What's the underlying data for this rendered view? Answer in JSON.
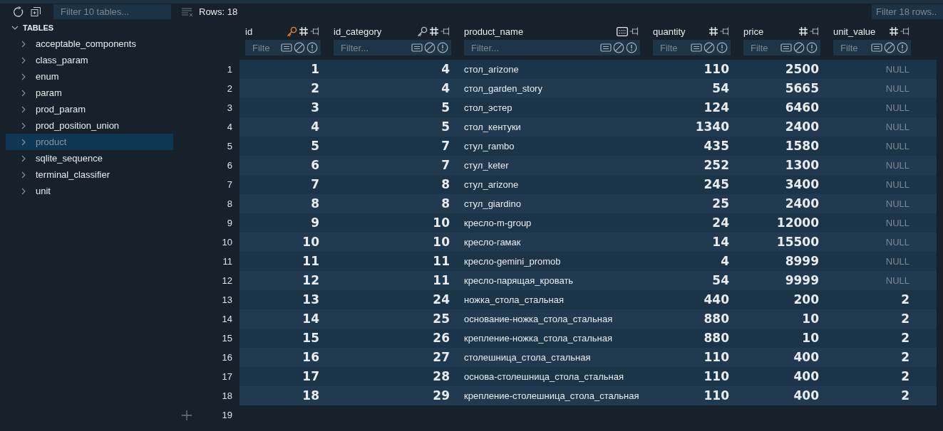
{
  "sidebar": {
    "filter_placeholder": "Filter 10 tables...",
    "section": {
      "label": "TABLES",
      "expanded": true
    },
    "items": [
      {
        "label": "acceptable_components",
        "selected": false
      },
      {
        "label": "class_param",
        "selected": false
      },
      {
        "label": "enum",
        "selected": false
      },
      {
        "label": "param",
        "selected": false
      },
      {
        "label": "prod_param",
        "selected": false
      },
      {
        "label": "prod_position_union",
        "selected": false
      },
      {
        "label": "product",
        "selected": true
      },
      {
        "label": "sqlite_sequence",
        "selected": false
      },
      {
        "label": "terminal_classifier",
        "selected": false
      },
      {
        "label": "unit",
        "selected": false
      }
    ]
  },
  "toolbar": {
    "rows_label": "Rows: 18",
    "filter_placeholder": "Filter 18 rows.."
  },
  "table": {
    "columns": [
      {
        "name": "id",
        "kind": "primary",
        "filter_placeholder": "Filte"
      },
      {
        "name": "id_category",
        "kind": "foreign",
        "filter_placeholder": "Filter..."
      },
      {
        "name": "product_name",
        "kind": "text",
        "filter_placeholder": "Filter..."
      },
      {
        "name": "quantity",
        "kind": "number",
        "filter_placeholder": "Filte"
      },
      {
        "name": "price",
        "kind": "number",
        "filter_placeholder": "Filte"
      },
      {
        "name": "unit_value",
        "kind": "number",
        "filter_placeholder": "Filte"
      }
    ],
    "rows": [
      {
        "number": "1",
        "cells": [
          "1",
          "4",
          "стол_arizone",
          "110",
          "2500",
          {
            "text": "NULL",
            "is_null": true
          }
        ]
      },
      {
        "number": "2",
        "cells": [
          "2",
          "4",
          "стол_garden_story",
          "54",
          "5665",
          {
            "text": "NULL",
            "is_null": true
          }
        ]
      },
      {
        "number": "3",
        "cells": [
          "3",
          "5",
          "стол_эстер",
          "124",
          "6460",
          {
            "text": "NULL",
            "is_null": true
          }
        ]
      },
      {
        "number": "4",
        "cells": [
          "4",
          "5",
          "стол_кентуки",
          "1340",
          "2400",
          {
            "text": "NULL",
            "is_null": true
          }
        ]
      },
      {
        "number": "5",
        "cells": [
          "5",
          "7",
          "стул_rambo",
          "435",
          "1580",
          {
            "text": "NULL",
            "is_null": true
          }
        ]
      },
      {
        "number": "6",
        "cells": [
          "6",
          "7",
          "стул_keter",
          "252",
          "1300",
          {
            "text": "NULL",
            "is_null": true
          }
        ]
      },
      {
        "number": "7",
        "cells": [
          "7",
          "8",
          "стул_arizone",
          "245",
          "3400",
          {
            "text": "NULL",
            "is_null": true
          }
        ]
      },
      {
        "number": "8",
        "cells": [
          "8",
          "8",
          "стул_giardino",
          "25",
          "2400",
          {
            "text": "NULL",
            "is_null": true
          }
        ]
      },
      {
        "number": "9",
        "cells": [
          "9",
          "10",
          "кресло-m-group",
          "24",
          "12000",
          {
            "text": "NULL",
            "is_null": true
          }
        ]
      },
      {
        "number": "10",
        "cells": [
          "10",
          "10",
          "кресло-гамак",
          "14",
          "15500",
          {
            "text": "NULL",
            "is_null": true
          }
        ]
      },
      {
        "number": "11",
        "cells": [
          "11",
          "11",
          "кресло-gemini_promob",
          "4",
          "8999",
          {
            "text": "NULL",
            "is_null": true
          }
        ]
      },
      {
        "number": "12",
        "cells": [
          "12",
          "11",
          "кресло-парящая_кровать",
          "54",
          "9999",
          {
            "text": "NULL",
            "is_null": true
          }
        ]
      },
      {
        "number": "13",
        "cells": [
          "13",
          "24",
          "ножка_стола_стальная",
          "440",
          "200",
          "2"
        ]
      },
      {
        "number": "14",
        "cells": [
          "14",
          "25",
          "основание-ножка_стола_стальная",
          "880",
          "10",
          "2"
        ]
      },
      {
        "number": "15",
        "cells": [
          "15",
          "26",
          "крепление-ножка_стола_стальная",
          "880",
          "10",
          "2"
        ]
      },
      {
        "number": "16",
        "cells": [
          "16",
          "27",
          "столешница_стола_стальная",
          "110",
          "400",
          "2"
        ]
      },
      {
        "number": "17",
        "cells": [
          "17",
          "28",
          "основа-столешница_стола_стальная",
          "110",
          "400",
          "2"
        ]
      },
      {
        "number": "18",
        "cells": [
          "18",
          "29",
          "крепление-столешница_стола_стальная",
          "110",
          "400",
          "2"
        ]
      }
    ],
    "new_row_number": "19"
  }
}
